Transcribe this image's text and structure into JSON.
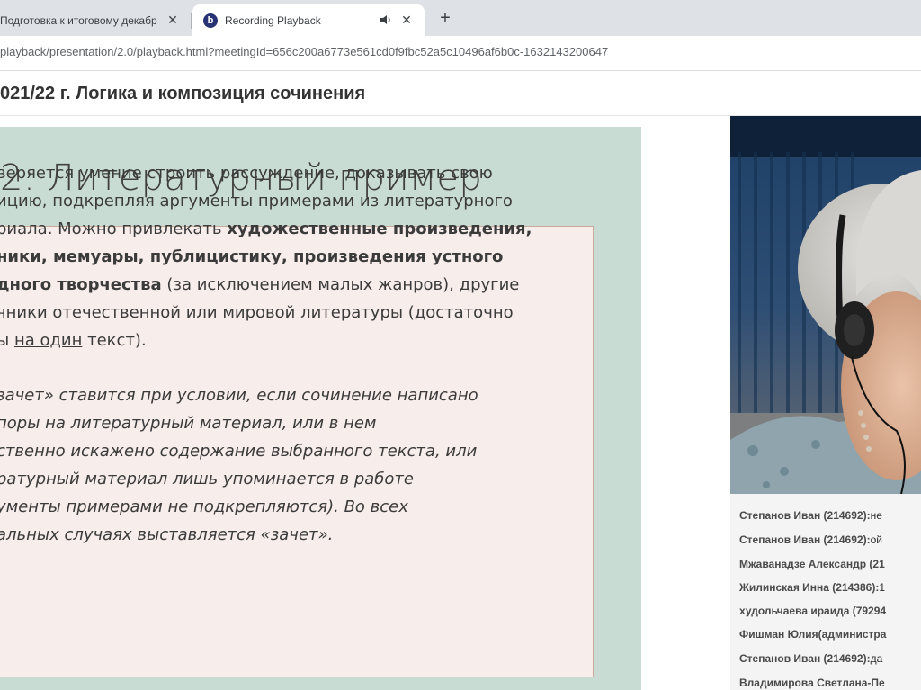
{
  "browser": {
    "tabs": [
      {
        "title": "Подготовка к итоговому декабр",
        "active": false
      },
      {
        "title": "Recording Playback",
        "active": true,
        "favicon_letter": "b"
      }
    ],
    "new_tab_label": "+",
    "close_label": "✕",
    "url": "playback/presentation/2.0/playback.html?meetingId=656c200a6773e561cd0f9fbc52a5c10496af6b0c-1632143200647"
  },
  "page": {
    "title": "021/22 г. Логика и композиция сочинения"
  },
  "slide": {
    "title": "2: Литературный пример",
    "paragraph1": [
      [
        {
          "t": "веряется умение строить рассуждение, доказывать свою"
        }
      ],
      [
        {
          "t": "ицию, подкрепляя аргументы примерами из литературного"
        }
      ],
      [
        {
          "t": "риала. Можно привлекать "
        },
        {
          "t": "художественные произведения,",
          "b": true
        }
      ],
      [
        {
          "t": "ники, мемуары, публицистику, произведения устного",
          "b": true
        }
      ],
      [
        {
          "t": "дного творчества",
          "b": true
        },
        {
          "t": " (за исключением малых жанров), другие"
        }
      ],
      [
        {
          "t": "чники отечественной или мировой литературы (достаточно"
        }
      ],
      [
        {
          "t": "ы "
        },
        {
          "t": "на один",
          "u": true
        },
        {
          "t": " текст)."
        }
      ]
    ],
    "paragraph2": [
      "зачет» ставится при условии, если сочинение написано",
      "поры на литературный материал, или в нем",
      "ственно искажено содержание выбранного текста, или",
      "ратурный материал лишь упоминается в работе",
      "ументы примерами не подкрепляются). Во всех",
      "альных случаях выставляется «зачет»."
    ]
  },
  "chat": {
    "messages": [
      {
        "name": "Степанов Иван (214692):",
        "text": "не"
      },
      {
        "name": "Степанов Иван (214692):",
        "text": "ой"
      },
      {
        "name": "Мжаванадзе Александр (21",
        "text": ""
      },
      {
        "name": "Жилинская Инна (214386):",
        "text": "1"
      },
      {
        "name": "худольчаева ираида (79294",
        "text": ""
      },
      {
        "name": "Фишман Юлия(администра",
        "text": ""
      },
      {
        "name": "Степанов Иван (214692):",
        "text": "да"
      },
      {
        "name": "Владимирова Светлана-Пе",
        "text": ""
      }
    ]
  },
  "colors": {
    "tabstrip": "#dee1e6",
    "slide_background": "#c8dcd4",
    "slide_box": "#f7edeb",
    "favicon": "#283274"
  },
  "icons": {
    "audio": "speaker-icon",
    "close": "close-icon",
    "new_tab": "plus-icon"
  }
}
